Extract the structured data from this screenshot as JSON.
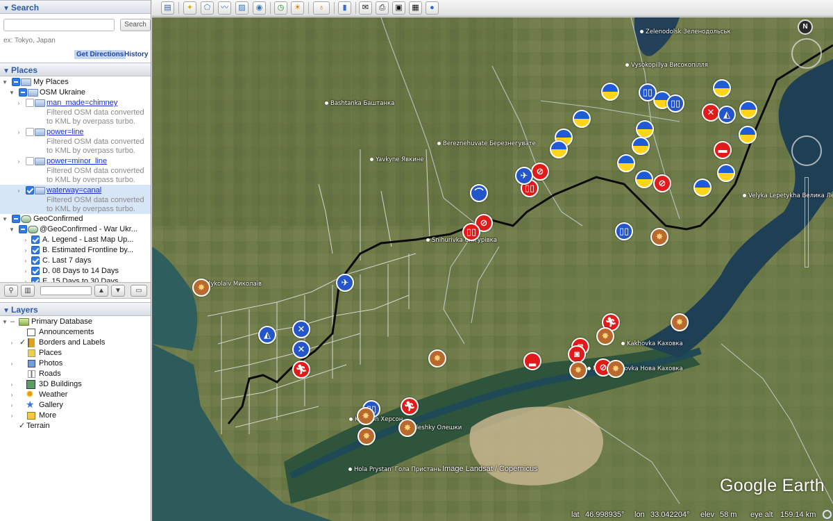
{
  "search": {
    "title": "Search",
    "placeholder": "",
    "button": "Search",
    "example": "ex: Tokyo, Japan",
    "get_directions": "Get Directions",
    "history": "History"
  },
  "places": {
    "title": "Places",
    "my_places": "My Places",
    "osm_ukraine": "OSM Ukraine",
    "items": [
      {
        "label": "man_made=chimney",
        "desc1": "Filtered OSM data converted",
        "desc2": "to KML by overpass turbo."
      },
      {
        "label": "power=line",
        "desc1": "Filtered OSM data converted",
        "desc2": "to KML by overpass turbo."
      },
      {
        "label": "power=minor_line",
        "desc1": "Filtered OSM data converted",
        "desc2": "to KML by overpass turbo."
      },
      {
        "label": "waterway=canal",
        "desc1": "Filtered OSM data converted",
        "desc2": "to KML by overpass turbo."
      }
    ],
    "geoconfirmed": "GeoConfirmed",
    "geoconfirmed_war": "@GeoConfirmed - War Ukr...",
    "sub_items": [
      "A. Legend - Last Map Up...",
      "B. Estimated Frontline by...",
      "C. Last 7 days",
      "D. 08 Days to 14 Days",
      "E. 15 Days to 30 Days"
    ]
  },
  "layers": {
    "title": "Layers",
    "primary_database": "Primary Database",
    "items": [
      "Announcements",
      "Borders and Labels",
      "Places",
      "Photos",
      "Roads",
      "3D Buildings",
      "Weather",
      "Gallery",
      "More"
    ],
    "terrain": "Terrain"
  },
  "map": {
    "labels": {
      "zelenodolsk": "Zelenodolsk Зеленодольськ",
      "vysokopillya": "Vysokopillya Високопілля",
      "bashtanka": "Bashtanka Баштанка",
      "bereznehuvate": "Bereznehuvate Березнегувате",
      "yavkyne": "Yavkyne Явкине",
      "velyka": "Velyka Lepetykha Велика Ле...",
      "snihurivka": "Snihurivka Снігурівка",
      "mykolaiv": "Mykolaiv Миколаїв",
      "kakhovka": "Kakhovka Каховка",
      "nova_kakhovka": "Nova Kakhovka Нова Каховка",
      "kherson": "Kherson Херсон",
      "oleshky": "Oleshky Олешки",
      "hola_prystan": "Hola Prystan' Гола Пристань"
    },
    "image_credit": "Image Landsat / Copernicus",
    "logo": "Google Earth",
    "compass": "N"
  },
  "status": {
    "lat_label": "lat",
    "lat": "46.998935°",
    "lon_label": "lon",
    "lon": "33.042204°",
    "elev_label": "elev",
    "elev": "58 m",
    "eye_label": "eye alt",
    "eye": "159.14 km"
  }
}
